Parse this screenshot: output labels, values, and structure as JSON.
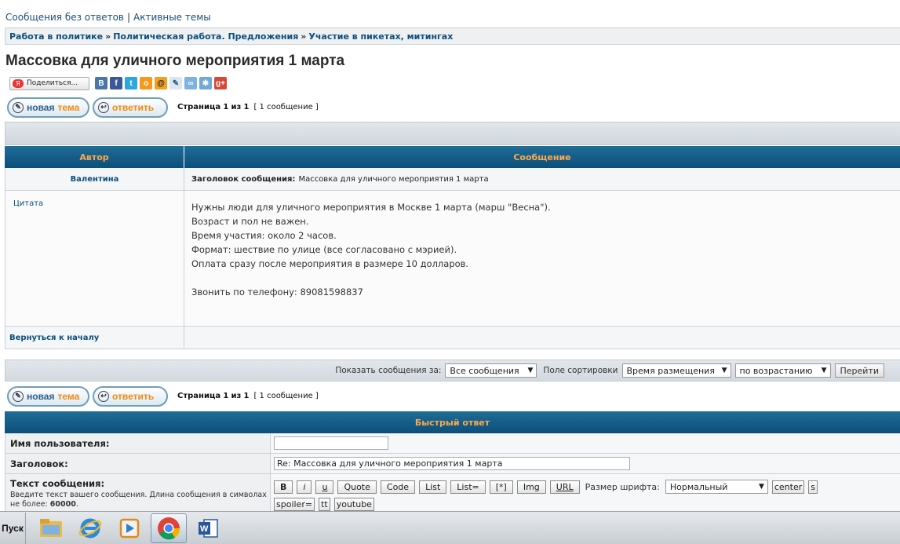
{
  "top_links": {
    "unanswered": "Сообщения без ответов",
    "separator": "|",
    "active": "Активные темы"
  },
  "breadcrumb": {
    "items": [
      "Работа в политике",
      "Политическая работа. Предложения",
      "Участие в пикетах, митингах"
    ],
    "separator": "»"
  },
  "topic_title": "Массовка для уличного мероприятия 1 марта",
  "share": {
    "button_label": "Поделиться...",
    "ya_glyph": "Я",
    "icons": [
      "vkontakte-icon",
      "facebook-icon",
      "twitter-icon",
      "odnoklassniki-icon",
      "mailru-icon",
      "livejournal-icon",
      "moikrug-icon",
      "liveinternet-icon",
      "googleplus-icon"
    ]
  },
  "buttons": {
    "new_topic_a": "новая",
    "new_topic_b": "тема",
    "reply": "ответить"
  },
  "pagination": {
    "prefix": "Страница",
    "current": "1",
    "of": "из",
    "total": "1",
    "count_text": "[ 1 сообщение ]"
  },
  "table": {
    "col_author": "Автор",
    "col_message": "Сообщение",
    "author": "Валентина",
    "subject_label": "Заголовок сообщения:",
    "subject": "Массовка для уличного мероприятия 1 марта",
    "quote_link": "Цитата",
    "body": [
      "Нужны люди для уличного мероприятия в Москве 1 марта (марш \"Весна\").",
      "Возраст и пол не важен.",
      "Время участия: около 2 часов.",
      "Формат: шествие по улице (все согласовано с мэрией).",
      "Оплата сразу после мероприятия в размере 10 долларов.",
      "",
      "Звонить по телефону: 89081598837"
    ],
    "back_to_top": "Вернуться к началу"
  },
  "sort": {
    "show_label": "Показать сообщения за:",
    "show_value": "Все сообщения",
    "field_label": "Поле сортировки",
    "field_value": "Время размещения",
    "order_value": "по возрастанию",
    "go": "Перейти"
  },
  "quick_reply": {
    "header": "Быстрый ответ",
    "username_label": "Имя пользователя:",
    "username_value": "",
    "subject_label": "Заголовок:",
    "subject_value": "Re: Массовка для уличного мероприятия 1 марта",
    "text_label": "Текст сообщения:",
    "text_hint_a": "Введите текст вашего сообщения. Длина сообщения в символах не более:",
    "text_hint_limit": "60000",
    "toolbar": [
      "B",
      "i",
      "u",
      "Quote",
      "Code",
      "List",
      "List=",
      "[*]",
      "Img",
      "URL"
    ],
    "font_size_label": "Размер шрифта:",
    "font_size_value": "Нормальный",
    "toolbar2": [
      "center",
      "s",
      "spoiler=",
      "tt",
      "youtube"
    ]
  },
  "taskbar": {
    "start": "Пуск",
    "apps": [
      "file-explorer-icon",
      "internet-explorer-icon",
      "media-player-icon",
      "chrome-icon",
      "word-icon"
    ],
    "active_app": "chrome-icon"
  },
  "colors": {
    "header_blue": "#0c4f7a",
    "header_text": "#ffa94a",
    "link_blue": "#0b4f7e"
  }
}
